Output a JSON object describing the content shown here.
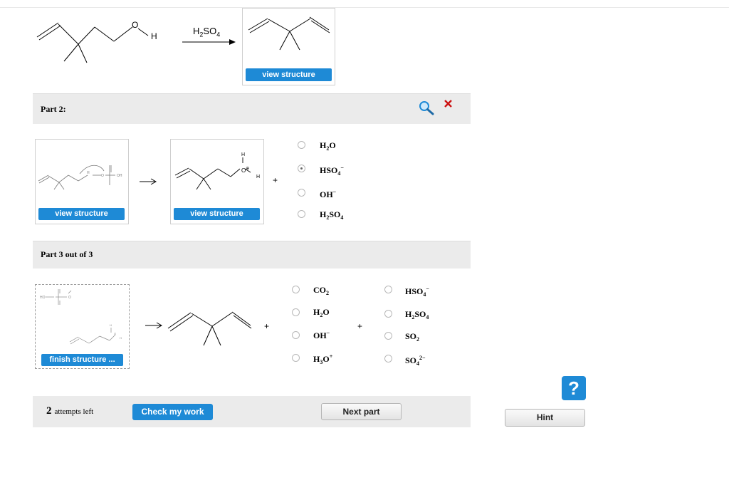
{
  "part1": {
    "reactant_o_label": "O",
    "reactant_h_label": "H",
    "reagent": {
      "formula": "H",
      "sub": "2",
      "rest": "SO",
      "sub2": "4"
    },
    "view_structure_label": "view structure"
  },
  "part2": {
    "label": "Part 2:",
    "view_structure_left": "view structure",
    "view_structure_right": "view structure",
    "product_labels": {
      "h_top": "H",
      "o": "O",
      "h_right": "H"
    },
    "plus": "+",
    "options": [
      {
        "main": "H",
        "sub": "2",
        "rest": "O",
        "sup": "",
        "checked": false
      },
      {
        "main": "HSO",
        "sub": "4",
        "rest": "",
        "sup": "−",
        "checked": true
      },
      {
        "main": "OH",
        "sub": "",
        "rest": "",
        "sup": "−",
        "checked": false
      },
      {
        "main": "H",
        "sub": "2",
        "rest": "SO",
        "sub2": "4",
        "sup": "",
        "checked": false
      }
    ]
  },
  "part3": {
    "label": "Part 3 out of 3",
    "finish_structure_label": "finish structure ...",
    "plus1": "+",
    "plus2": "+",
    "options_left": [
      {
        "main": "CO",
        "sub": "2",
        "sup": ""
      },
      {
        "main": "H",
        "sub": "2",
        "rest": "O",
        "sup": ""
      },
      {
        "main": "OH",
        "sub": "",
        "sup": "−"
      },
      {
        "main": "H",
        "sub": "3",
        "rest": "O",
        "sup": "+"
      }
    ],
    "options_right": [
      {
        "main": "HSO",
        "sub": "4",
        "sup": "−"
      },
      {
        "main": "H",
        "sub": "2",
        "rest": "SO",
        "sub2": "4",
        "sup": ""
      },
      {
        "main": "SO",
        "sub": "2",
        "sup": ""
      },
      {
        "main": "SO",
        "sub": "4",
        "sup": "2−"
      }
    ]
  },
  "footer": {
    "attempts_number": "2",
    "attempts_text": "attempts left",
    "check_label": "Check my work",
    "next_label": "Next part",
    "hint_label": "Hint",
    "help_glyph": "?"
  },
  "colors": {
    "accent": "#1e8ad6",
    "close": "#cc1111",
    "search": "#1e8ad6"
  },
  "icons": {
    "search": "search-icon",
    "close": "close-icon",
    "help": "help-icon"
  }
}
